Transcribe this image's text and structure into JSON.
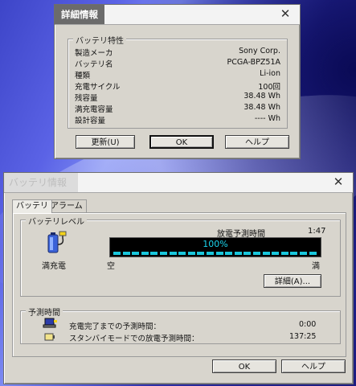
{
  "details_dialog": {
    "title": "詳細情報",
    "close_icon": "close-icon",
    "group_label": "バッテリ特性",
    "rows": [
      {
        "label": "製造メーカ",
        "value": "Sony Corp."
      },
      {
        "label": "バッテリ名",
        "value": "PCGA-BPZ51A"
      },
      {
        "label": "種類",
        "value": "Li-ion"
      },
      {
        "label": "充電サイクル",
        "value": "100回"
      },
      {
        "label": "残容量",
        "value": "38.48 Wh"
      },
      {
        "label": "満充電容量",
        "value": "38.48 Wh"
      },
      {
        "label": "設計容量",
        "value": "---- Wh"
      }
    ],
    "buttons": {
      "update": "更新(U)",
      "ok": "OK",
      "help": "ヘルプ"
    }
  },
  "battery_window": {
    "title": "バッテリ情報",
    "tabs": [
      "バッテリ",
      "アラーム"
    ],
    "level_group": {
      "label": "バッテリレベル",
      "status": "満充電",
      "status_icon": "battery-plug-icon",
      "discharge_label": "放電予測時間",
      "discharge_time": "1:47",
      "gauge_percent_text": "100%",
      "gauge_level": 1.0,
      "gauge_color": "#19c7dc",
      "empty_label": "空",
      "full_label": "満",
      "details_button": "詳細(A)..."
    },
    "estimate_group": {
      "label": "予測時間",
      "rows": [
        {
          "icon": "laptop-charge-icon",
          "label": "充電完了までの予測時間：",
          "value": "0:00"
        },
        {
          "icon": "standby-battery-icon",
          "label": "スタンバイモードでの放電予測時間：",
          "value": "137:25"
        }
      ]
    },
    "buttons": {
      "ok": "OK",
      "help": "ヘルプ"
    }
  }
}
